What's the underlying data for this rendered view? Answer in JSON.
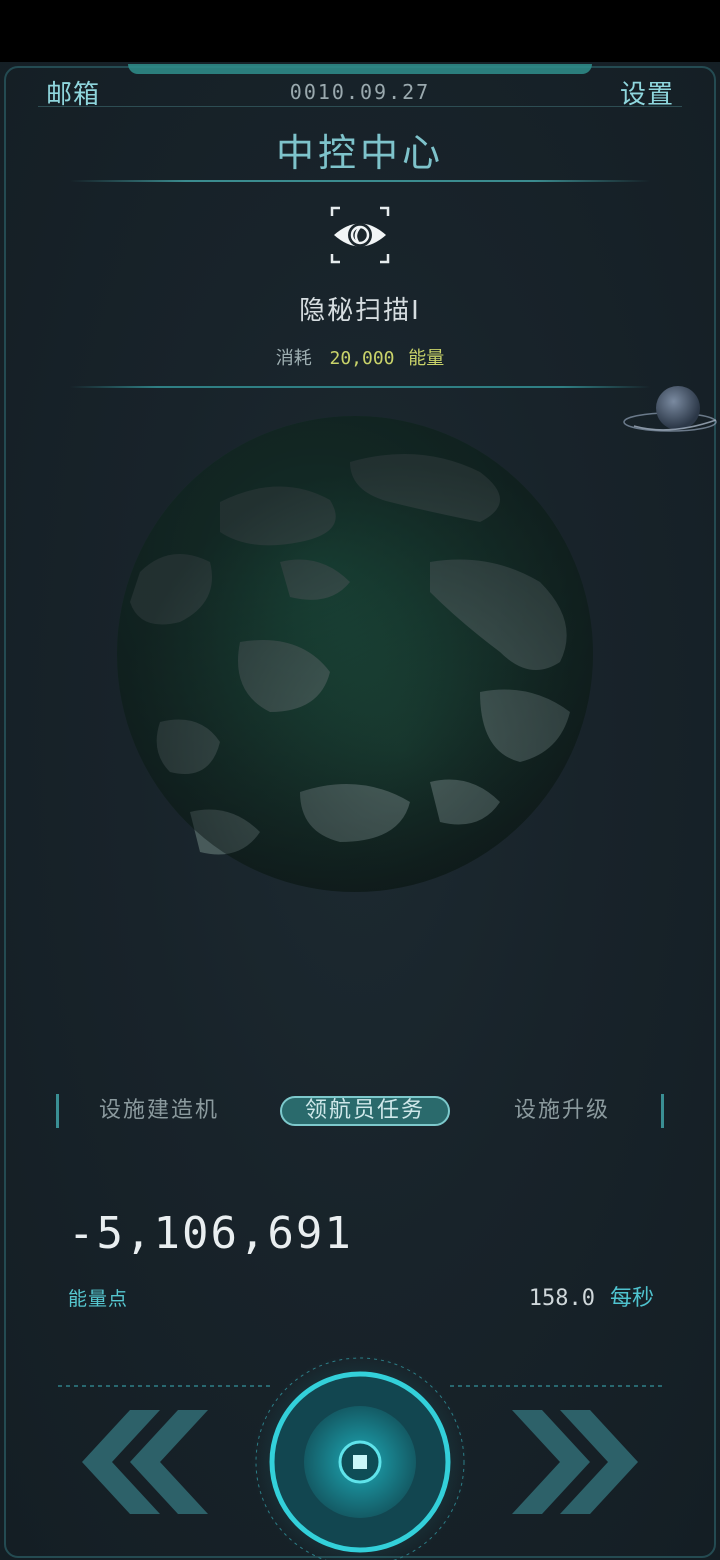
{
  "header": {
    "mailbox_label": "邮箱",
    "date": "0010.09.27",
    "settings_label": "设置",
    "title": "中控中心"
  },
  "scan": {
    "icon": "eye-scan-icon",
    "name": "隐秘扫描I",
    "cost_label": "消耗",
    "cost_value": "20,000",
    "cost_unit": "能量"
  },
  "tabs": [
    {
      "label": "设施建造机",
      "active": false
    },
    {
      "label": "领航员任务",
      "active": true
    },
    {
      "label": "设施升级",
      "active": false
    }
  ],
  "stats": {
    "energy_value": "-5,106,691",
    "energy_label": "能量点",
    "rate_value": "158.0",
    "rate_unit": "每秒"
  },
  "controls": {
    "left_icon": "double-chevron-left-icon",
    "center_icon": "core-button-icon",
    "right_icon": "double-chevron-right-icon"
  },
  "colors": {
    "accent": "#4fc3cf",
    "title": "#7ec3cb",
    "cost": "#c9d36a",
    "panel_bg": "#18232a"
  }
}
